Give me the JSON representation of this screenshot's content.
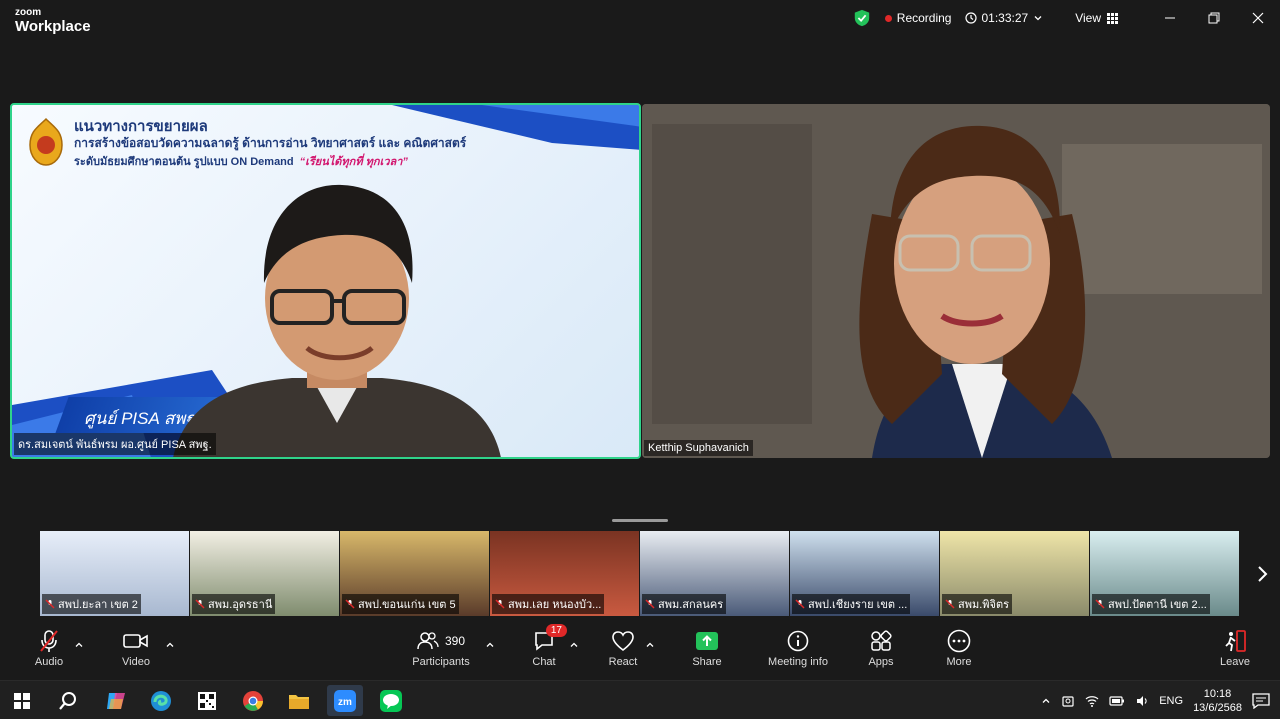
{
  "app": {
    "brand_top": "zoom",
    "brand_bottom": "Workplace"
  },
  "titlebar": {
    "recording_label": "Recording",
    "timer": "01:33:27",
    "view_label": "View"
  },
  "colors": {
    "accent_green": "#2fd38a",
    "record_red": "#e02828",
    "share_green": "#23c25a"
  },
  "main_tiles": [
    {
      "name": "ดร.สมเจตน์ พันธ์พรม ผอ.ศูนย์ PISA สพฐ.",
      "slide_title": "แนวทางการขยายผล",
      "slide_line2": "การสร้างข้อสอบวัดความฉลาดรู้ ด้านการอ่าน วิทยาศาสตร์ และ คณิตศาสตร์",
      "slide_line3": "ระดับมัธยมศึกษาตอนต้น รูปแบบ ON Demand",
      "slide_highlight": "“เรียนได้ทุกที่ ทุกเวลา”",
      "banner_text": "ศูนย์ PISA สพฐ"
    },
    {
      "name": "Ketthip Suphavanich"
    }
  ],
  "filmstrip": [
    {
      "name": "สพป.ยะลา เขต 2"
    },
    {
      "name": "สพม.อุดรธานี"
    },
    {
      "name": "สพป.ขอนแก่น เขต 5"
    },
    {
      "name": "สพม.เลย หนองบัว..."
    },
    {
      "name": "สพม.สกลนคร"
    },
    {
      "name": "สพป.เชียงราย เขต ..."
    },
    {
      "name": "สพม.พิจิตร"
    },
    {
      "name": "สพป.ปัตตานี เขต 2..."
    }
  ],
  "toolbar": {
    "audio": "Audio",
    "video": "Video",
    "participants": "Participants",
    "participants_count": "390",
    "chat": "Chat",
    "chat_badge": "17",
    "react": "React",
    "share": "Share",
    "meeting_info": "Meeting info",
    "apps": "Apps",
    "more": "More",
    "leave": "Leave"
  },
  "taskbar": {
    "lang": "ENG",
    "time": "10:18",
    "date": "13/6/2568"
  }
}
